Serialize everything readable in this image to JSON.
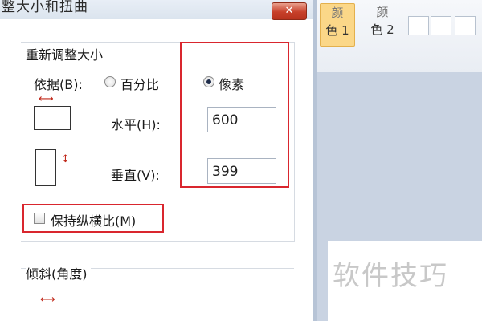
{
  "dialog": {
    "title": "整大小和扭曲",
    "close_icon": "close-icon",
    "resize": {
      "section_title": "重新调整大小",
      "by_label": "依据(B):",
      "percent_label": "百分比",
      "pixels_label": "像素",
      "selected": "pixels",
      "horizontal_label": "水平(H):",
      "horizontal_value": "600",
      "vertical_label": "垂直(V):",
      "vertical_value": "399",
      "maintain_ratio_label": "保持纵横比(M)",
      "maintain_ratio_checked": false
    },
    "skew": {
      "section_title": "倾斜(角度)"
    }
  },
  "toolbar": {
    "color1_label": "颜\n色 1",
    "color1_top": "颜",
    "color1_bottom": "色 1",
    "color2_top": "颜",
    "color2_bottom": "色 2"
  },
  "watermark": "软件技巧",
  "colors": {
    "highlight": "#d9262e",
    "active_color_button": "#fbd788",
    "canvas_background": "#c9d3e2"
  }
}
